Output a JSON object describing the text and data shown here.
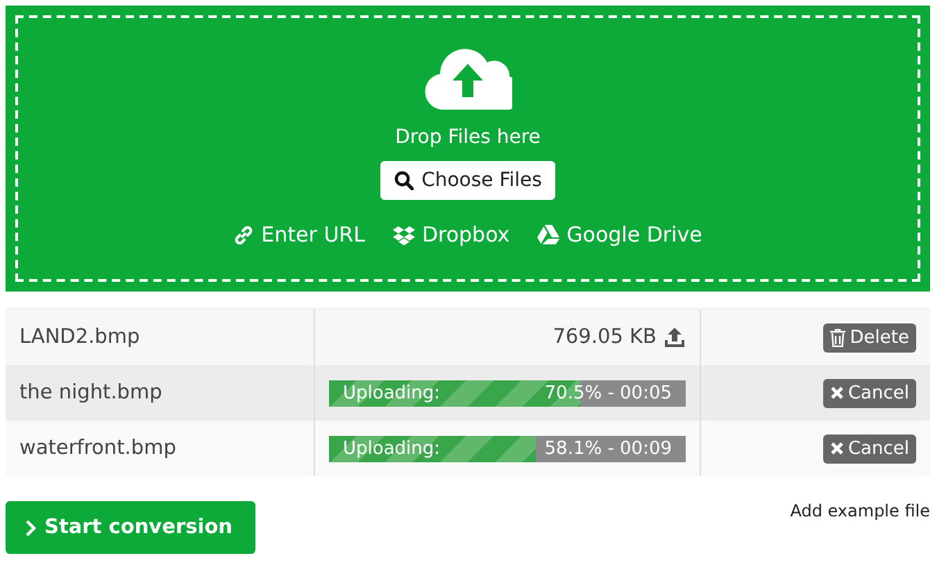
{
  "dropzone": {
    "prompt": "Drop Files here",
    "choose_button": "Choose Files",
    "sources": [
      {
        "kind": "url",
        "label": "Enter URL"
      },
      {
        "kind": "dropbox",
        "label": "Dropbox"
      },
      {
        "kind": "drive",
        "label": "Google Drive"
      }
    ]
  },
  "files": [
    {
      "kind": "uploaded",
      "name": "LAND2.bmp",
      "size": "769.05 KB",
      "action": "Delete"
    },
    {
      "kind": "uploading",
      "name": "the night.bmp",
      "status": "Uploading:",
      "progress": "70.5% - 00:05",
      "level": 0.705,
      "action": "Cancel"
    },
    {
      "kind": "uploading",
      "name": "waterfront.bmp",
      "status": "Uploading:",
      "progress": "58.1% - 00:09",
      "level": 0.581,
      "action": "Cancel"
    }
  ],
  "start_button": "Start conversion",
  "example_link": "Add example file"
}
